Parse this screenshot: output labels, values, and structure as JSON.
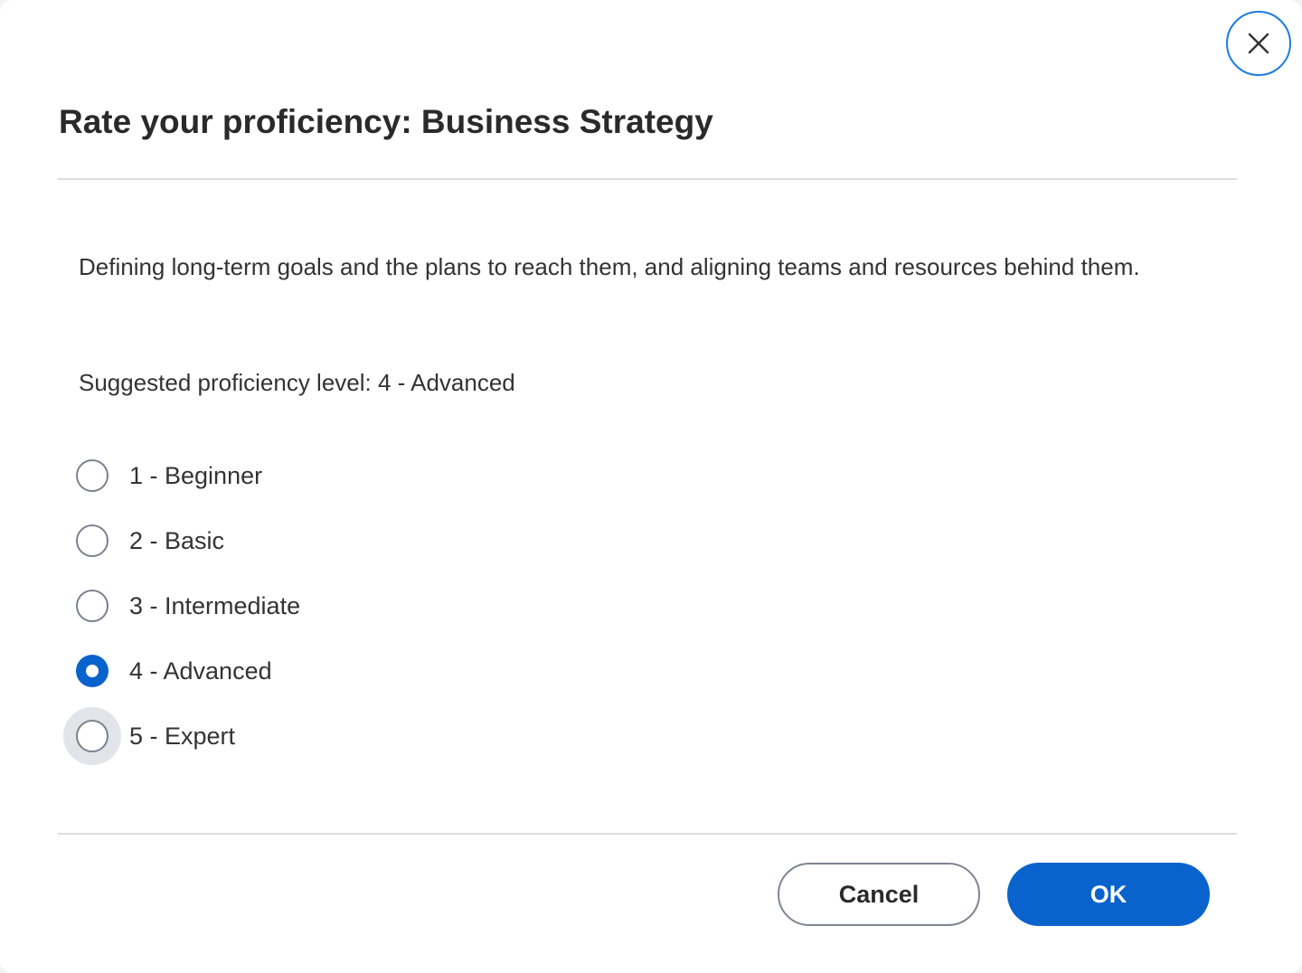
{
  "dialog": {
    "title": "Rate your proficiency: Business Strategy",
    "description": "Defining long-term goals and the plans to reach them, and aligning teams and resources behind them.",
    "suggested": "Suggested proficiency level: 4 - Advanced",
    "close_icon": "close-icon"
  },
  "options": [
    {
      "label": "1 - Beginner",
      "selected": false
    },
    {
      "label": "2 - Basic",
      "selected": false
    },
    {
      "label": "3 - Intermediate",
      "selected": false
    },
    {
      "label": "4 - Advanced",
      "selected": true
    },
    {
      "label": "5 - Expert",
      "selected": false,
      "hovered": true
    }
  ],
  "footer": {
    "cancel_label": "Cancel",
    "ok_label": "OK"
  },
  "colors": {
    "accent": "#0a63cc",
    "focus_ring": "#1e7be0",
    "text": "#333333"
  }
}
